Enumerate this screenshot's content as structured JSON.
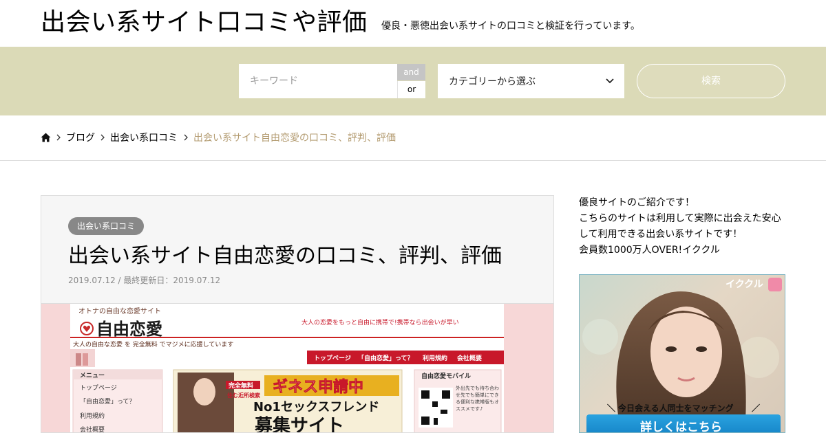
{
  "header": {
    "site_title": "出会い系サイト口コミや評価",
    "site_description": "優良・悪徳出会い系サイトの口コミと検証を行っています。"
  },
  "search": {
    "keyword_placeholder": "キーワード",
    "and_label": "and",
    "or_label": "or",
    "category_label": "カテゴリーから選ぶ",
    "search_button": "検索"
  },
  "breadcrumb": {
    "items": [
      "ブログ",
      "出会い系口コミ"
    ],
    "current": "出会い系サイト自由恋愛の口コミ、評判、評価"
  },
  "article": {
    "category": "出会い系口コミ",
    "title": "出会い系サイト自由恋愛の口コミ、評判、評価",
    "date": "2019.07.12 / 最終更新日：2019.07.12"
  },
  "screenshot": {
    "tagline": "オトナの自由な恋愛サイト",
    "logo": "自由恋愛",
    "sub_tagline": "大人の自由な恋愛 を 完全無料 でマジメに応援しています",
    "top_message": "大人の恋愛をもっと自由に携帯で!携帯なら出会いが早い",
    "nav": [
      "トップページ",
      "「自由恋愛」って？",
      "利用規約",
      "会社概要"
    ],
    "menu_title": "メニュー",
    "menu_items": [
      "トップページ",
      "「自由恋愛」って？",
      "利用規約",
      "会社概要"
    ],
    "banner_free": "完全無料",
    "banner_free2": "住む近所検索",
    "banner_main": "ギネス申請中",
    "banner_no1": "No1セックスフレンド",
    "banner_bottom": "募集サイト",
    "mobile_title": "自由恋愛モバイル",
    "mobile_text": "外出先でも待ち合わせ先でも簡単にできる便利な携帯版もオススメです♪"
  },
  "sidebar": {
    "lines": [
      "優良サイトのご紹介です！",
      "こちらのサイトは利用して実際に出会えた安心",
      "して利用できる出会い系サイトです！",
      "会員数1000万人OVER!イククル"
    ],
    "banner_brand": "イククル",
    "banner_tagline": "今日会える人同士をマッチング",
    "banner_button": "詳しくはこちら"
  },
  "colors": {
    "search_band": "#dbdab7",
    "breadcrumb_current": "#b39b70",
    "badge": "#888888"
  }
}
